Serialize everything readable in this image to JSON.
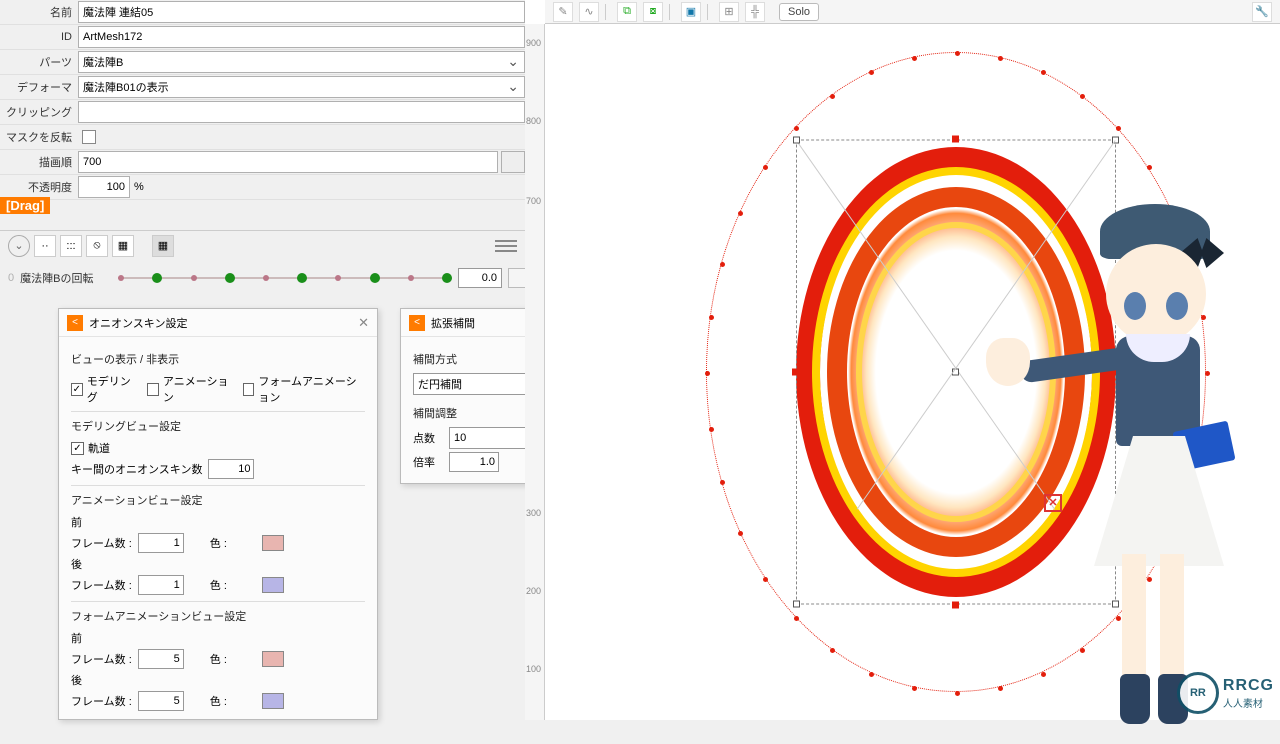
{
  "props": {
    "name_label": "名前",
    "name_value": "魔法陣 連結05",
    "id_label": "ID",
    "id_value": "ArtMesh172",
    "parts_label": "パーツ",
    "parts_value": "魔法陣B",
    "deformer_label": "デフォーマ",
    "deformer_value": "魔法陣B01の表示",
    "clipping_label": "クリッピング",
    "clipping_value": "",
    "invert_mask_label": "マスクを反転",
    "draw_order_label": "描画順",
    "draw_order_value": "700",
    "opacity_label": "不透明度",
    "opacity_value": "100",
    "opacity_unit": "%"
  },
  "drag_label": "[Drag]",
  "param": {
    "index": "0",
    "name": "魔法陣Bの回転",
    "value": "0.0"
  },
  "onion": {
    "title": "オニオンスキン設定",
    "view_toggle": "ビューの表示 / 非表示",
    "chk_modeling": "モデリング",
    "chk_anim": "アニメーション",
    "chk_form_anim": "フォームアニメーション",
    "modeling_sec": "モデリングビュー設定",
    "chk_track": "軌道",
    "between_label": "キー間のオニオンスキン数",
    "between_value": "10",
    "anim_sec": "アニメーションビュー設定",
    "before": "前",
    "after": "後",
    "frames_label": "フレーム数 :",
    "color_label": "色 :",
    "anim_before_frames": "1",
    "anim_after_frames": "1",
    "form_sec": "フォームアニメーションビュー設定",
    "form_before_frames": "5",
    "form_after_frames": "5",
    "color_before": "#e8b5b0",
    "color_after": "#b7b5e6",
    "color_fb": "#e8b5b0",
    "color_fa": "#b7b5e6"
  },
  "interp": {
    "title": "拡張補間",
    "method_label": "補間方式",
    "method_value": "だ円補間",
    "adjust_label": "補間調整",
    "points_label": "点数",
    "points_value": "10",
    "ratio_label": "倍率",
    "ratio_value": "1.0"
  },
  "ruler": {
    "t900": "900",
    "t800": "800",
    "t700": "700",
    "t300": "300",
    "t200": "200",
    "t100": "100"
  },
  "toolbar": {
    "solo": "Solo"
  },
  "watermark": {
    "badge": "RR",
    "line1": "RRCG",
    "line2": "人人素材"
  }
}
